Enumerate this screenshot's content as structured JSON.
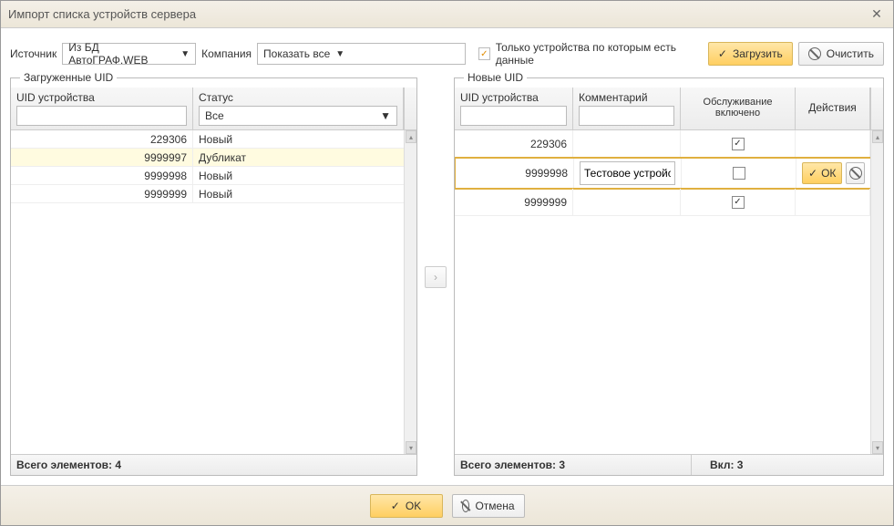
{
  "window": {
    "title": "Импорт списка устройств сервера"
  },
  "toolbar": {
    "sourceLabel": "Источник",
    "sourceValue": "Из БД АвтоГРАФ.WEB",
    "companyLabel": "Компания",
    "companyValue": "Показать все",
    "onlyDataLabel": "Только устройства по которым есть данные",
    "loadBtn": "Загрузить",
    "clearBtn": "Очистить"
  },
  "leftPanel": {
    "legend": "Загруженные UID",
    "headers": {
      "uid": "UID устройства",
      "status": "Статус"
    },
    "statusFilter": "Все",
    "rows": [
      {
        "uid": "229306",
        "status": "Новый",
        "hl": false
      },
      {
        "uid": "9999997",
        "status": "Дубликат",
        "hl": true
      },
      {
        "uid": "9999998",
        "status": "Новый",
        "hl": false
      },
      {
        "uid": "9999999",
        "status": "Новый",
        "hl": false
      }
    ],
    "footer": "Всего элементов: 4"
  },
  "rightPanel": {
    "legend": "Новые UID",
    "headers": {
      "uid": "UID устройства",
      "comment": "Комментарий",
      "service": "Обслуживание включено",
      "actions": "Действия"
    },
    "rows": [
      {
        "uid": "229306",
        "comment": "",
        "service": true,
        "editing": false
      },
      {
        "uid": "9999998",
        "comment": "Тестовое устройств",
        "service": false,
        "editing": true
      },
      {
        "uid": "9999999",
        "comment": "",
        "service": true,
        "editing": false
      }
    ],
    "okLabel": "ОК",
    "footerTotal": "Всего элементов: 3",
    "footerEnabled": "Вкл: 3"
  },
  "footer": {
    "ok": "OK",
    "cancel": "Отмена"
  }
}
